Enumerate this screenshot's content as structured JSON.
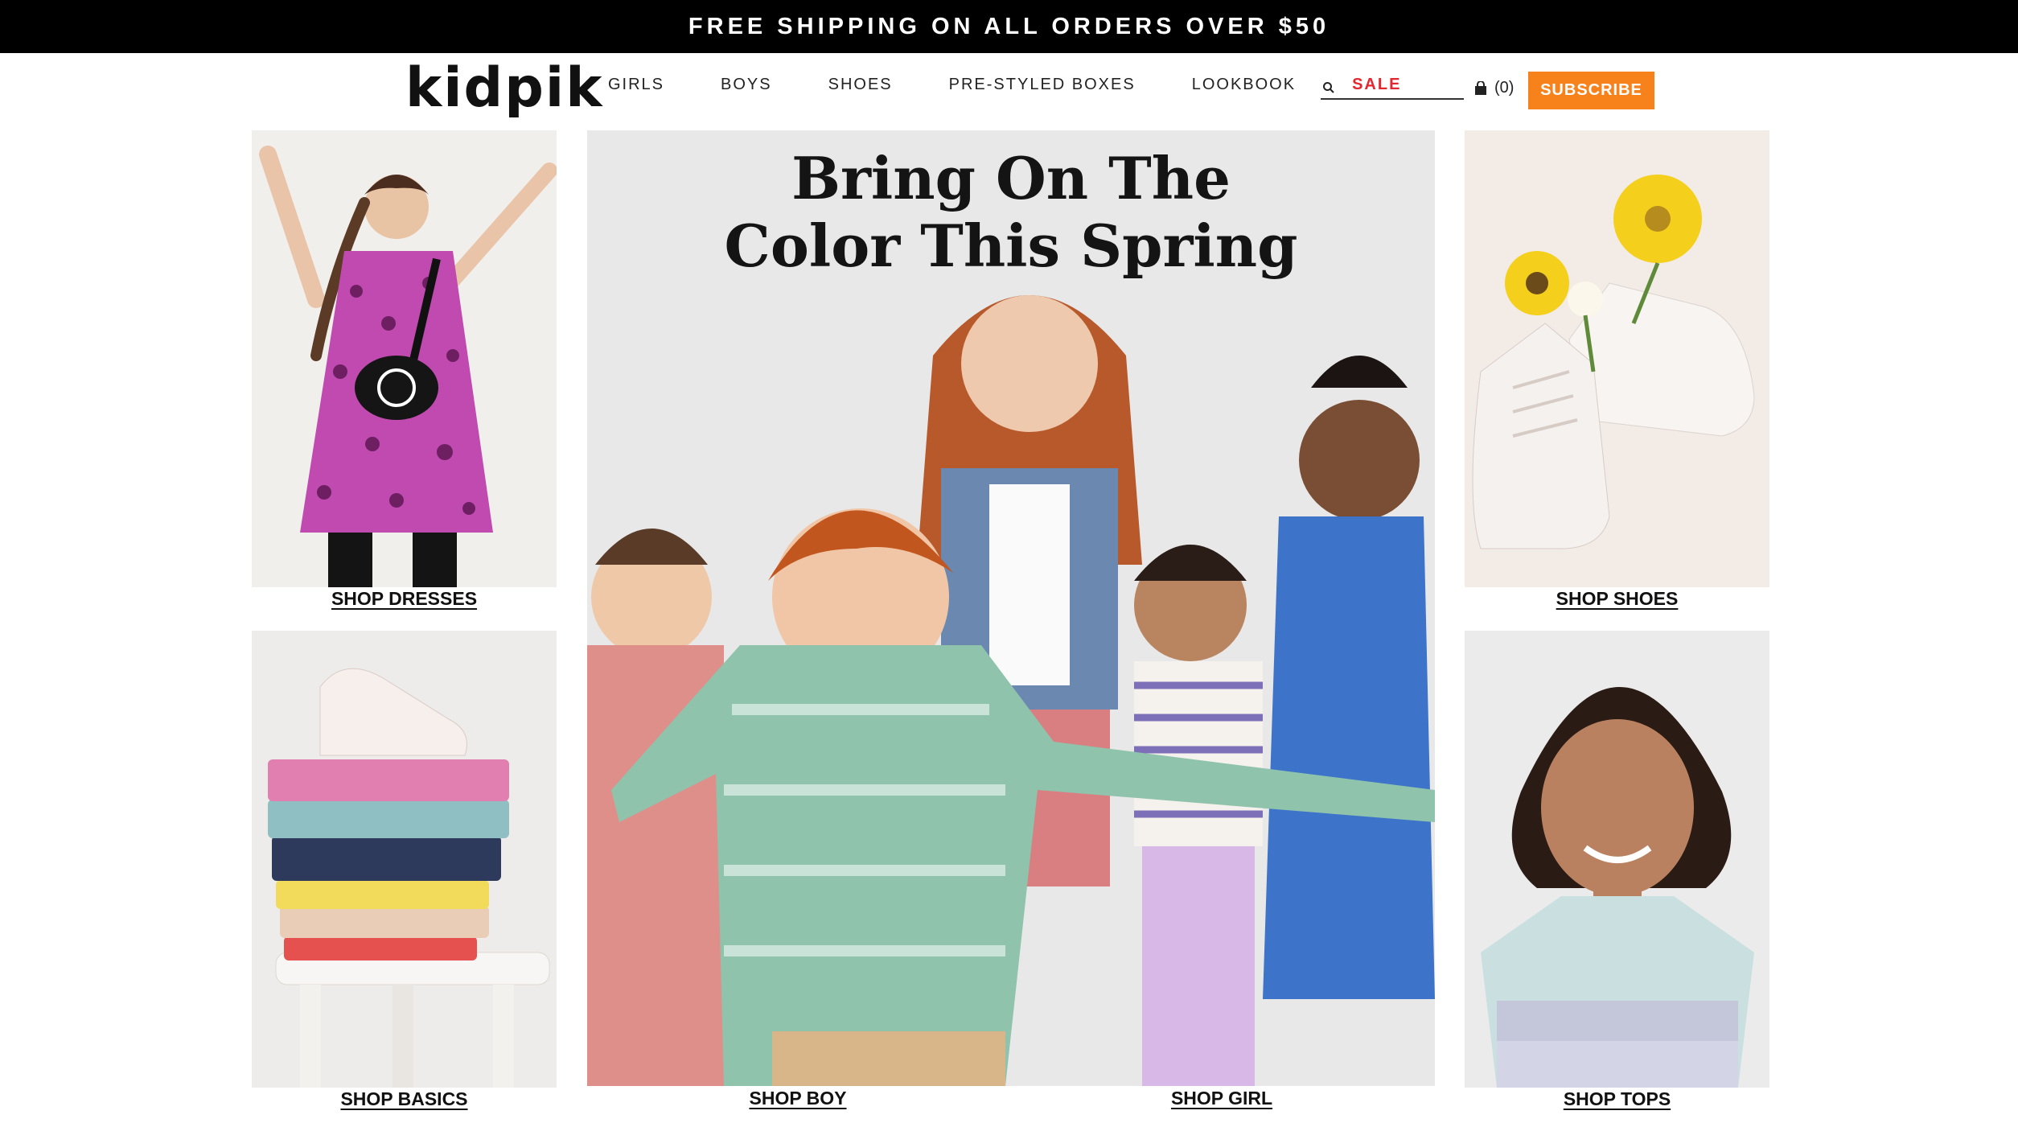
{
  "promo": {
    "text": "FREE SHIPPING ON ALL ORDERS OVER $50"
  },
  "header": {
    "logo": "kidpik",
    "nav": [
      {
        "label": "GIRLS"
      },
      {
        "label": "BOYS"
      },
      {
        "label": "SHOES"
      },
      {
        "label": "PRE-STYLED BOXES"
      },
      {
        "label": "LOOKBOOK"
      },
      {
        "label": "SALE"
      }
    ],
    "search": {
      "placeholder": ""
    },
    "cart": {
      "count": "(0)"
    },
    "subscribe_label": "SUBSCRIBE"
  },
  "hero": {
    "title_line1": "Bring On The",
    "title_line2": "Color This Spring"
  },
  "tiles": {
    "dresses": "SHOP DRESSES",
    "shoes": "SHOP SHOES",
    "basics": "SHOP BASICS",
    "boy": "SHOP BOY",
    "girl": "SHOP GIRL",
    "tops": "SHOP TOPS"
  },
  "colors": {
    "promo_bg": "#000000",
    "subscribe": "#f7821b",
    "sale": "#e3262f"
  }
}
